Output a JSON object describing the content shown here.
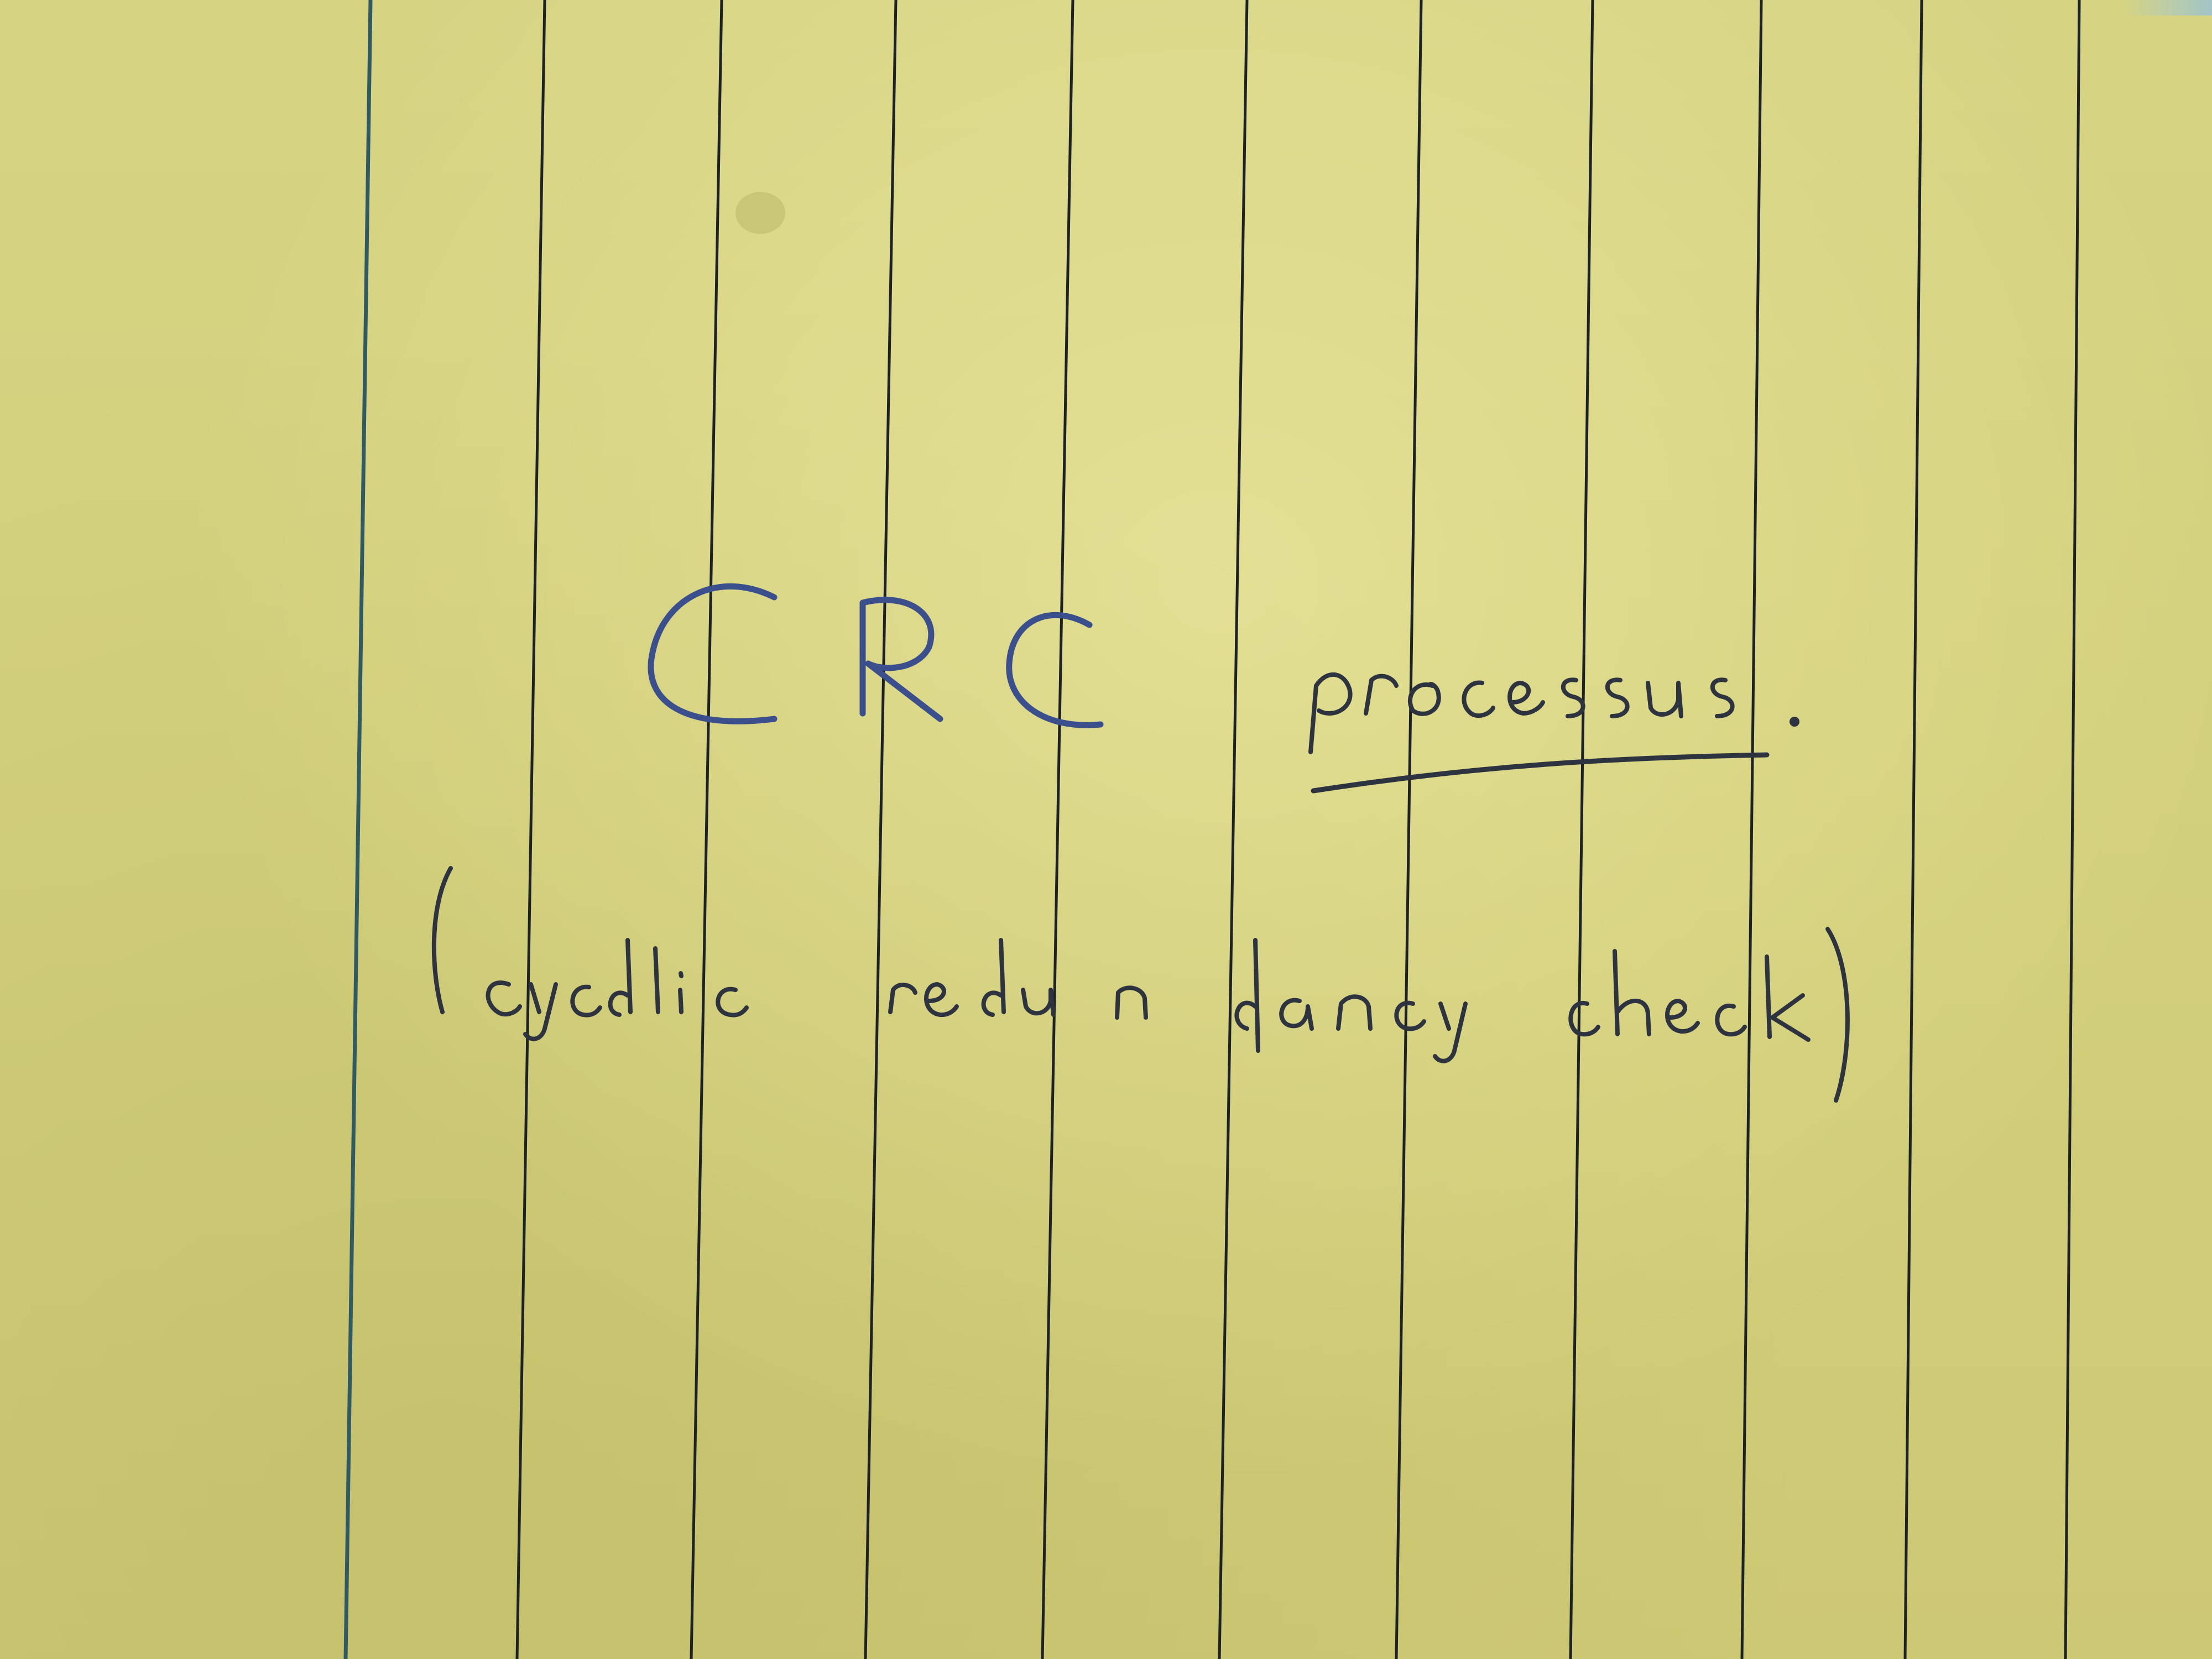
{
  "note": {
    "title": "CRC",
    "title_suffix": "processus.",
    "subtitle": "(cyclic redundancy check)"
  },
  "colors": {
    "paper": "#d4d17e",
    "ruled_line": "#1c2226",
    "margin_line": "#2f5a63",
    "ink_title": "#3a4f8c",
    "ink_pencil": "#2e3340"
  }
}
